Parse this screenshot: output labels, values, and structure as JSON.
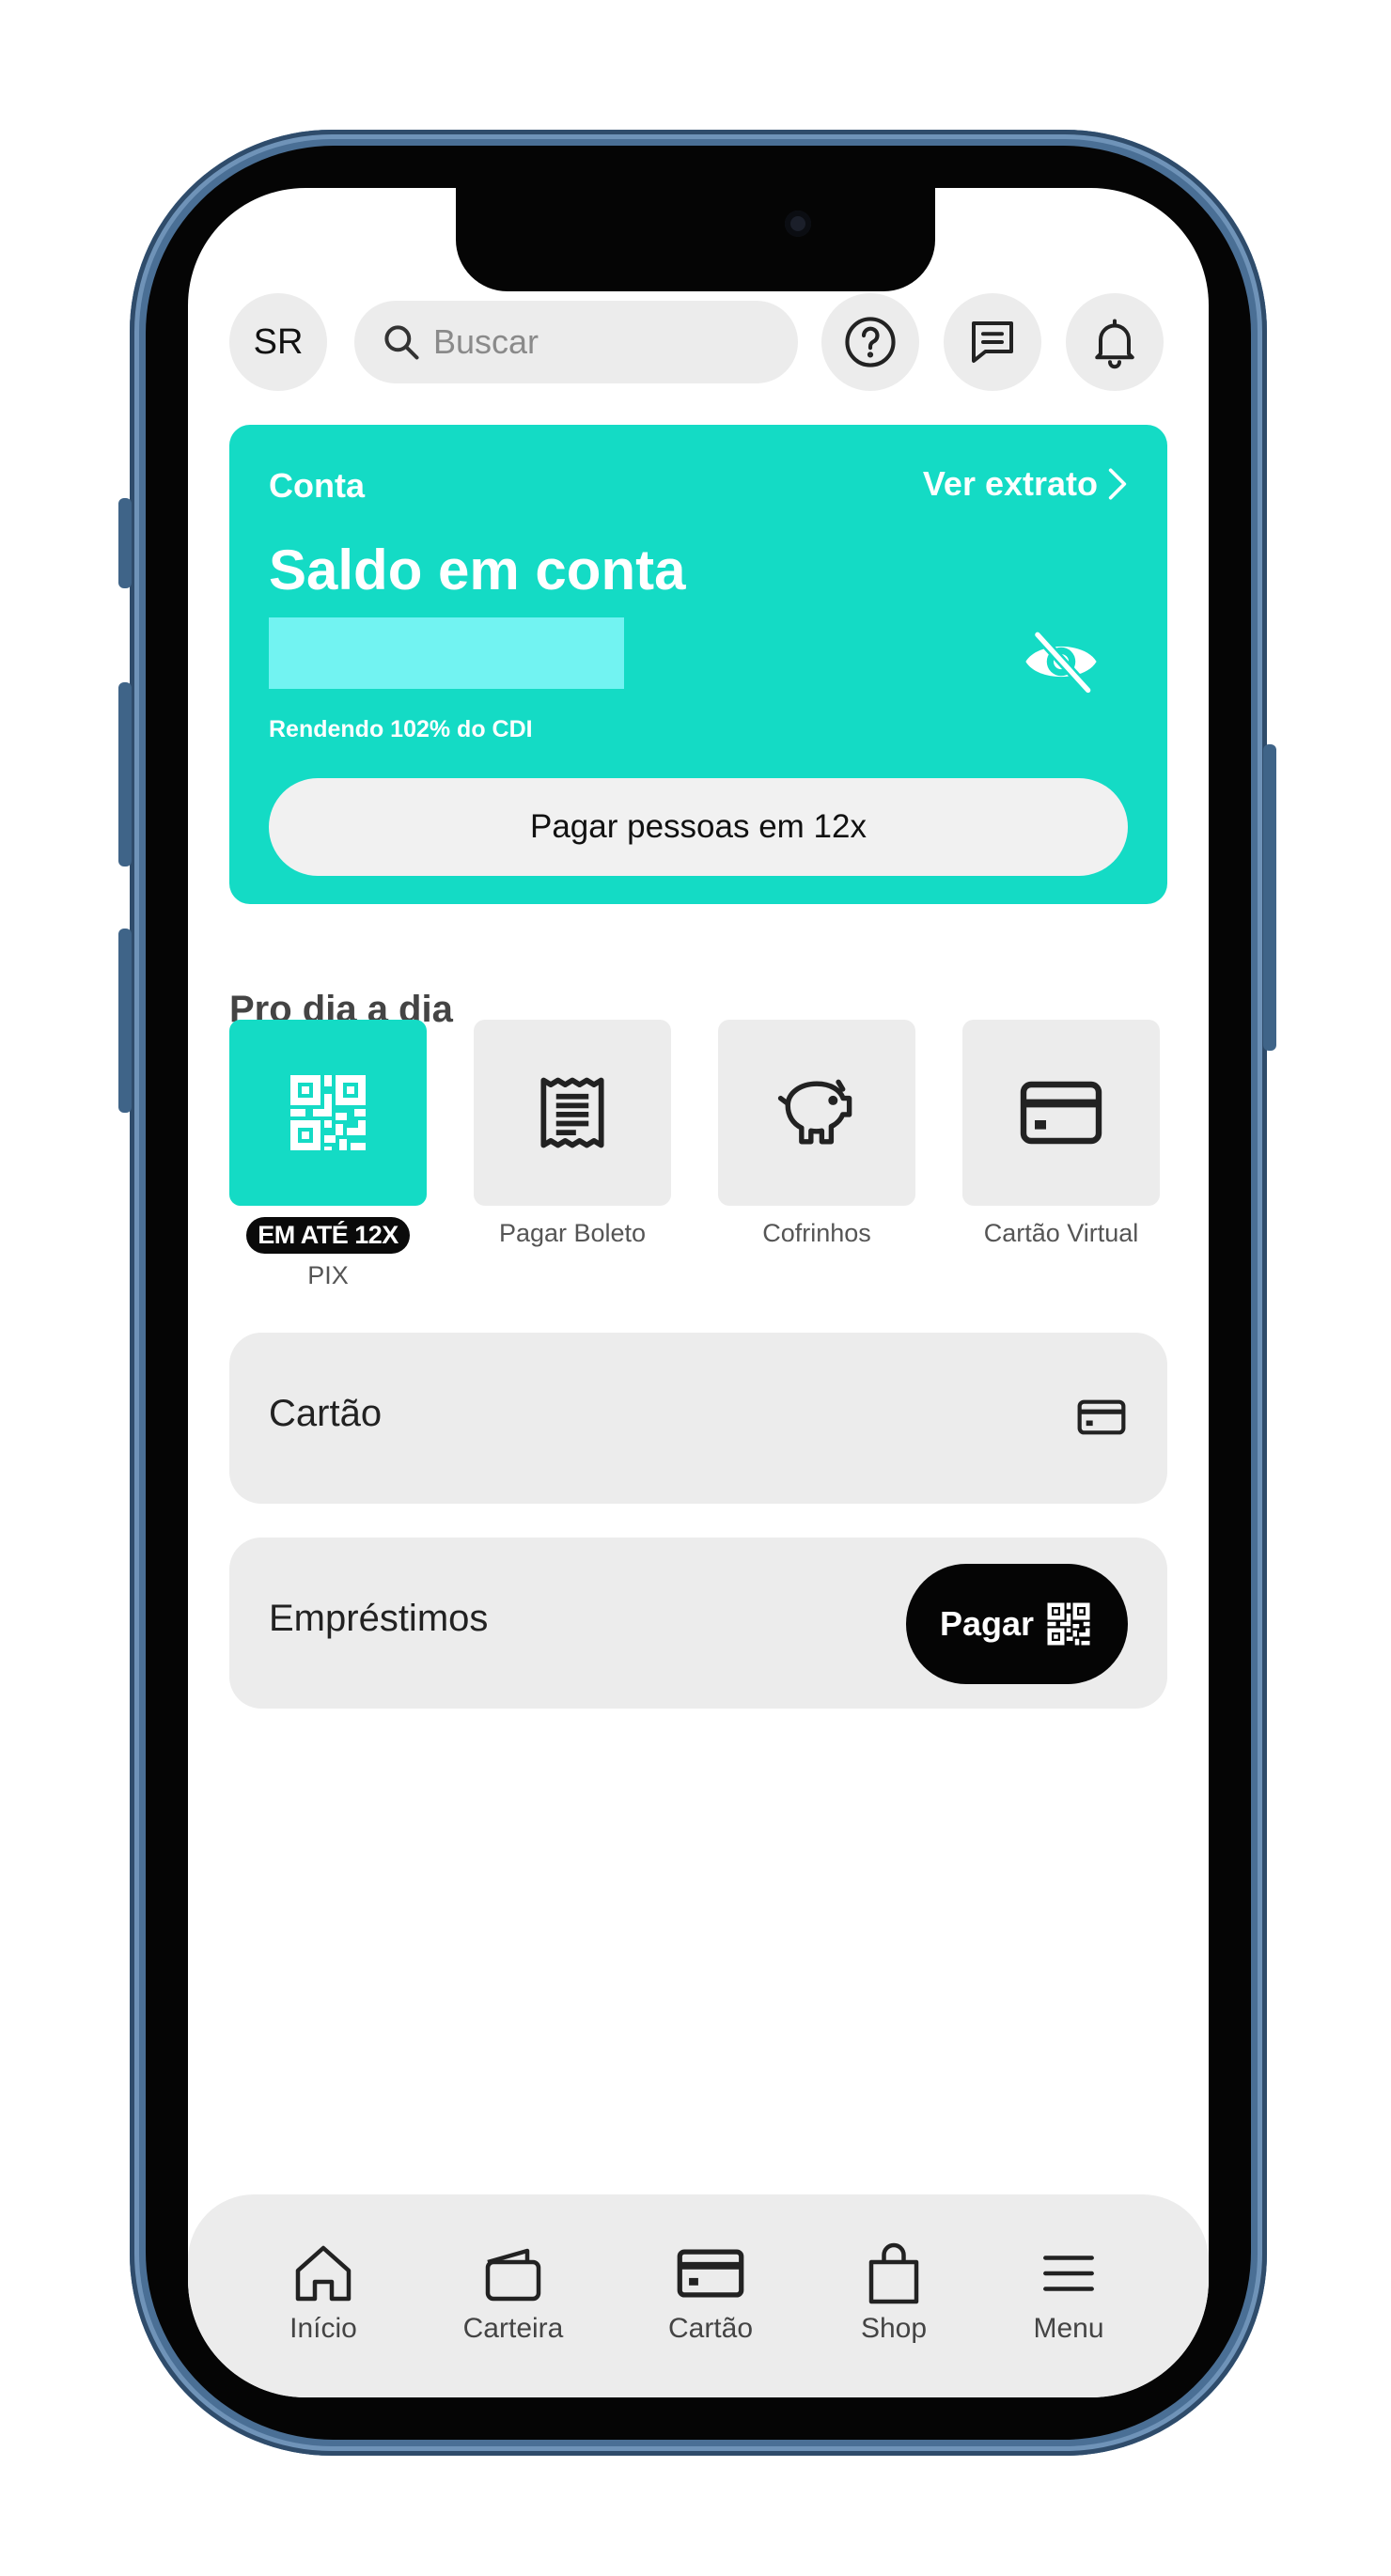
{
  "header": {
    "avatar_initials": "SR",
    "search_placeholder": "Buscar"
  },
  "account_card": {
    "label": "Conta",
    "statement_link": "Ver extrato",
    "title": "Saldo em conta",
    "yield_text": "Rendendo 102% do CDI",
    "pay_button": "Pagar pessoas em 12x",
    "color": "#14dbc5"
  },
  "daily": {
    "title": "Pro dia a dia",
    "actions": [
      {
        "label": "PIX",
        "badge": "EM ATÉ 12X",
        "icon": "qr-code-icon"
      },
      {
        "label": "Pagar Boleto",
        "icon": "receipt-icon"
      },
      {
        "label": "Cofrinhos",
        "icon": "piggy-bank-icon"
      },
      {
        "label": "Cartão Virtual",
        "icon": "credit-card-icon"
      }
    ]
  },
  "rows": {
    "card_label": "Cartão",
    "loans_label": "Empréstimos",
    "pay_label": "Pagar"
  },
  "nav": {
    "items": [
      {
        "label": "Início",
        "icon": "home-icon"
      },
      {
        "label": "Carteira",
        "icon": "wallet-icon"
      },
      {
        "label": "Cartão",
        "icon": "credit-card-icon"
      },
      {
        "label": "Shop",
        "icon": "shopping-bag-icon"
      },
      {
        "label": "Menu",
        "icon": "hamburger-icon"
      }
    ]
  }
}
